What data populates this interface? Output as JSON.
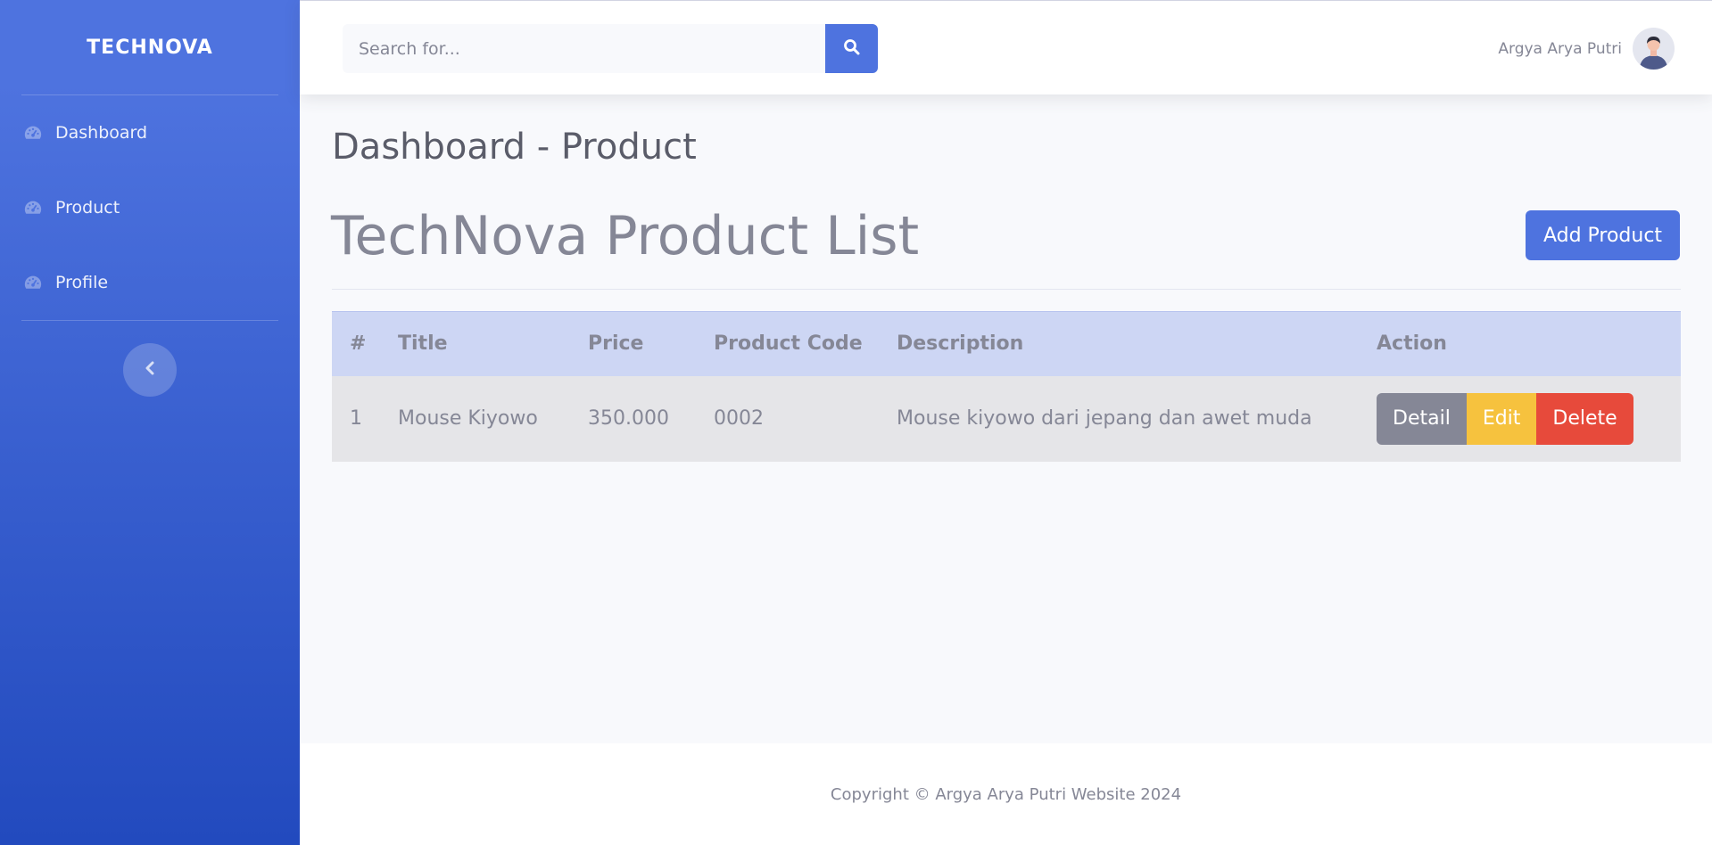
{
  "sidebar": {
    "brand": "TECHNOVA",
    "items": [
      {
        "label": "Dashboard",
        "icon": "tachometer-icon"
      },
      {
        "label": "Product",
        "icon": "tachometer-icon"
      },
      {
        "label": "Profile",
        "icon": "tachometer-icon"
      }
    ],
    "toggle_icon": "chevron-left-icon"
  },
  "topbar": {
    "search_placeholder": "Search for...",
    "search_icon": "search-icon",
    "user_name": "Argya Arya Putri"
  },
  "main": {
    "page_title": "Dashboard - Product",
    "list_title": "TechNova Product List",
    "add_button": "Add Product",
    "table": {
      "headers": [
        "#",
        "Title",
        "Price",
        "Product Code",
        "Description",
        "Action"
      ],
      "rows": [
        {
          "num": "1",
          "title": "Mouse Kiyowo",
          "price": "350.000",
          "code": "0002",
          "description": "Mouse kiyowo dari jepang dan awet muda",
          "actions": [
            "Detail",
            "Edit",
            "Delete"
          ]
        }
      ]
    }
  },
  "footer": {
    "text": "Copyright © Argya Arya Putri Website 2024"
  },
  "colors": {
    "primary": "#4e73df",
    "secondary": "#858796",
    "warning": "#f6c23e",
    "danger": "#e74a3b"
  }
}
